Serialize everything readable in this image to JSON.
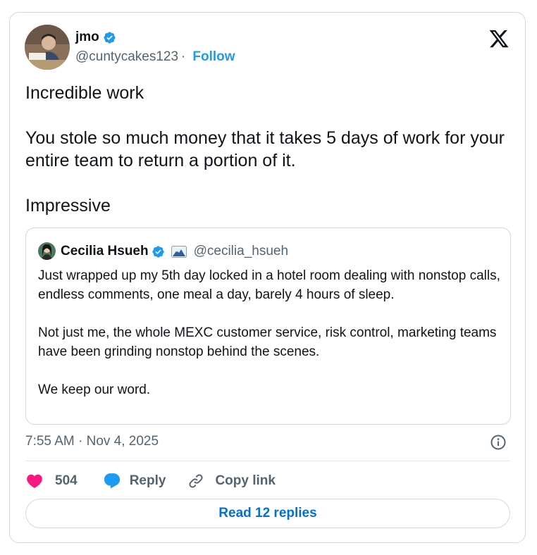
{
  "author": {
    "name": "jmo",
    "handle": "@cuntycakes123",
    "separator": "·",
    "follow_label": "Follow"
  },
  "tweet": {
    "paragraphs": [
      "Incredible work",
      "You stole so much money that it takes 5 days of work for your entire team to return a portion of it.",
      "Impressive"
    ]
  },
  "quote": {
    "name": "Cecilia Hsueh",
    "handle": "@cecilia_hsueh",
    "paragraphs": [
      "Just wrapped up my 5th day locked in a hotel room dealing with nonstop calls, endless comments, one meal a day, barely 4 hours of sleep.",
      "Not just me, the whole MEXC customer service, risk control, marketing teams have been grinding nonstop behind the scenes.",
      "We keep our word."
    ]
  },
  "timestamp": "7:55 AM · Nov 4, 2025",
  "actions": {
    "like_count": "504",
    "reply_label": "Reply",
    "copy_label": "Copy link"
  },
  "read_replies_label": "Read 12 replies",
  "icons": {
    "verified": "verified-badge-icon",
    "x_logo": "x-logo-icon",
    "info": "info-icon",
    "heart": "heart-icon",
    "reply": "reply-bubble-icon",
    "link": "link-icon",
    "flag": "mountain-flag-icon"
  },
  "colors": {
    "accent": "#1d9bf0",
    "heart": "#f91880",
    "muted": "#536471",
    "text": "#0f1419",
    "border": "#cfd9de",
    "read_replies_text": "#006fd6"
  }
}
